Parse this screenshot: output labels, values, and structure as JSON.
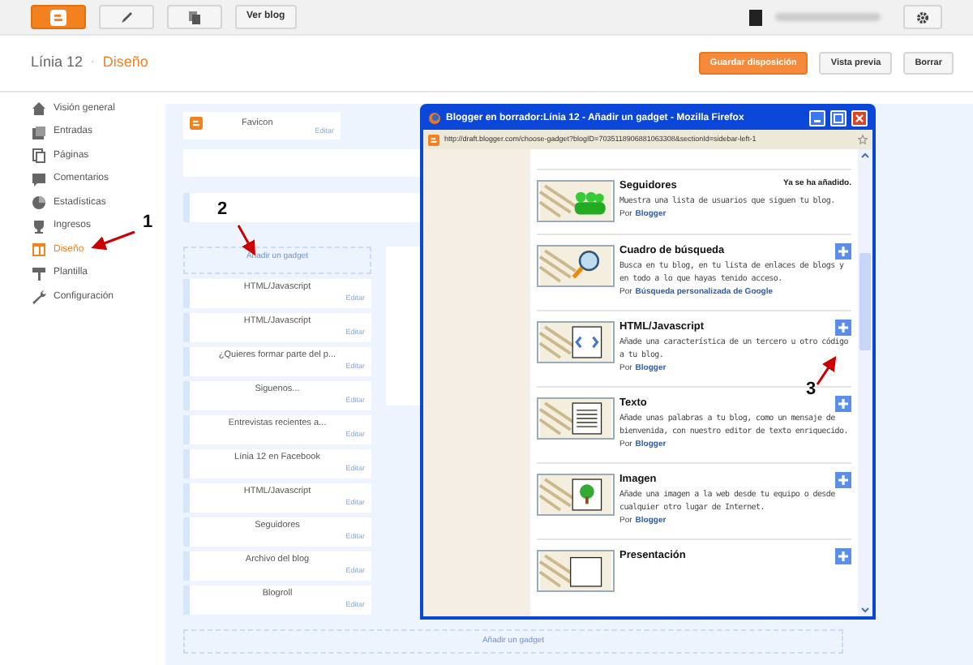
{
  "top_bar": {
    "buttons": [
      {
        "kind": "logo"
      },
      {
        "kind": "pencil"
      },
      {
        "kind": "pages"
      },
      {
        "kind": "text",
        "label": "Ver blog"
      }
    ]
  },
  "header": {
    "blog_name": "Línia 12",
    "separator": "·",
    "page": "Diseño",
    "buttons": [
      {
        "label": "Guardar disposición",
        "primary": true
      },
      {
        "label": "Vista previa",
        "primary": false
      },
      {
        "label": "Borrar",
        "primary": false
      }
    ]
  },
  "sidebar": {
    "items": [
      {
        "label": "Visión general",
        "selected": false
      },
      {
        "label": "Entradas",
        "selected": false
      },
      {
        "label": "Páginas",
        "selected": false
      },
      {
        "label": "Comentarios",
        "selected": false
      },
      {
        "label": "Estadísticas",
        "selected": false
      },
      {
        "label": "Ingresos",
        "selected": false
      },
      {
        "label": "Diseño",
        "selected": true
      },
      {
        "label": "Plantilla",
        "selected": false
      },
      {
        "label": "Configuración",
        "selected": false
      }
    ]
  },
  "layout": {
    "favicon": {
      "title": "Favicon",
      "edit": "Editar"
    },
    "add_gadget_top": "Añadir un gadget",
    "widgets": [
      {
        "title": "HTML/Javascript",
        "edit": "Editar"
      },
      {
        "title": "HTML/Javascript",
        "edit": "Editar"
      },
      {
        "title": "¿Quieres formar parte del p...",
        "edit": "Editar"
      },
      {
        "title": "Siguenos...",
        "edit": "Editar"
      },
      {
        "title": "Entrevistas recientes a...",
        "edit": "Editar"
      },
      {
        "title": "Línia 12 en Facebook",
        "edit": "Editar"
      },
      {
        "title": "HTML/Javascript",
        "edit": "Editar"
      },
      {
        "title": "Seguidores",
        "edit": "Editar"
      },
      {
        "title": "Archivo del blog",
        "edit": "Editar"
      },
      {
        "title": "Blogroll",
        "edit": "Editar"
      }
    ],
    "add_gadget_bottom": "Añadir un gadget"
  },
  "popup": {
    "title": "Blogger en borrador:Línia 12 - Añadir un gadget - Mozilla Firefox",
    "url": "http://draft.blogger.com/choose-gadget?blogID=7035118906881063308&sectionId=sidebar-left-1",
    "gadgets": [
      {
        "kind": "people",
        "title": "Seguidores",
        "added": true,
        "status": "Ya se ha añadido.",
        "description": "Muestra una lista de usuarios que siguen tu blog.",
        "by": "Por",
        "author": "Blogger"
      },
      {
        "kind": "magnifier",
        "title": "Cuadro de búsqueda",
        "added": false,
        "description": "Busca en tu blog, en tu lista de enlaces de blogs y en todo a lo que hayas tenido acceso.",
        "by": "Por",
        "author": "Búsqueda personalizada de Google"
      },
      {
        "kind": "code",
        "title": "HTML/Javascript",
        "added": false,
        "description": "Añade una característica de un tercero u otro código a tu blog.",
        "by": "Por",
        "author": "Blogger"
      },
      {
        "kind": "text",
        "title": "Texto",
        "added": false,
        "description": "Añade unas palabras a tu blog, como un mensaje de bienvenida, con nuestro editor de texto enriquecido.",
        "by": "Por",
        "author": "Blogger"
      },
      {
        "kind": "image",
        "title": "Imagen",
        "added": false,
        "description": "Añade una imagen a la web desde tu equipo o desde cualquier otro lugar de Internet.",
        "by": "Por",
        "author": "Blogger"
      },
      {
        "kind": "slides",
        "title": "Presentación",
        "added": false
      }
    ]
  },
  "annotations": [
    {
      "number": "1"
    },
    {
      "number": "2"
    },
    {
      "number": "3"
    }
  ]
}
